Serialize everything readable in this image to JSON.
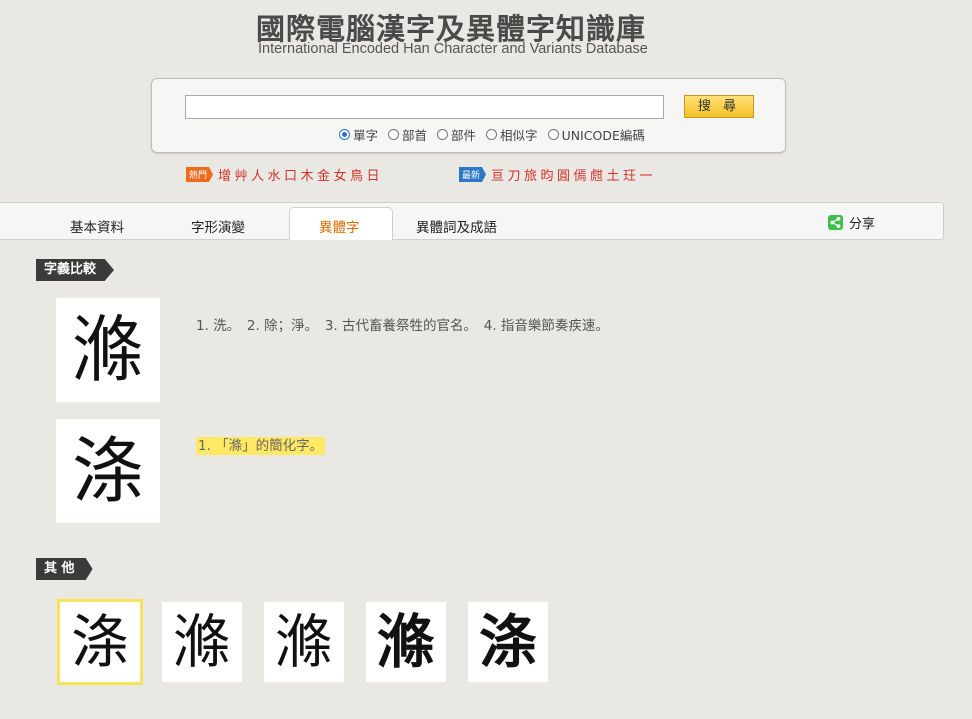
{
  "header": {
    "title_cn": "國際電腦漢字及異體字知識庫",
    "title_en": "International Encoded Han Character and Variants Database"
  },
  "search": {
    "value": "",
    "button_label": "搜 尋",
    "options": [
      {
        "label": "單字",
        "selected": true
      },
      {
        "label": "部首",
        "selected": false
      },
      {
        "label": "部件",
        "selected": false
      },
      {
        "label": "相似字",
        "selected": false
      },
      {
        "label": "UNICODE編碼",
        "selected": false
      }
    ]
  },
  "hot": {
    "badge": "熱門",
    "chars": "增艸人水口木金女鳥日"
  },
  "new": {
    "badge": "最新",
    "chars": "亘刀旅昀圓傿甝土玨一"
  },
  "tabs": [
    {
      "label": "基本資料"
    },
    {
      "label": "字形演變"
    },
    {
      "label": "異體字"
    },
    {
      "label": "異體詞及成語"
    }
  ],
  "share_label": "分享",
  "sections": {
    "compare": "字義比較",
    "other": "其 他"
  },
  "compare": [
    {
      "glyph": "滌",
      "meaning": "1. 洗。　2. 除；淨。　3. 古代畜養祭牲的官名。　4. 指音樂節奏疾速。"
    },
    {
      "glyph": "涤",
      "meaning": "1. 「滌」的簡化字。"
    }
  ],
  "others": [
    "涤",
    "滌",
    "滌",
    "滌",
    "涤"
  ],
  "colors": {
    "accent_tab": "#e46a00",
    "highlight": "#ffe863",
    "hot_text": "#d0312d"
  }
}
